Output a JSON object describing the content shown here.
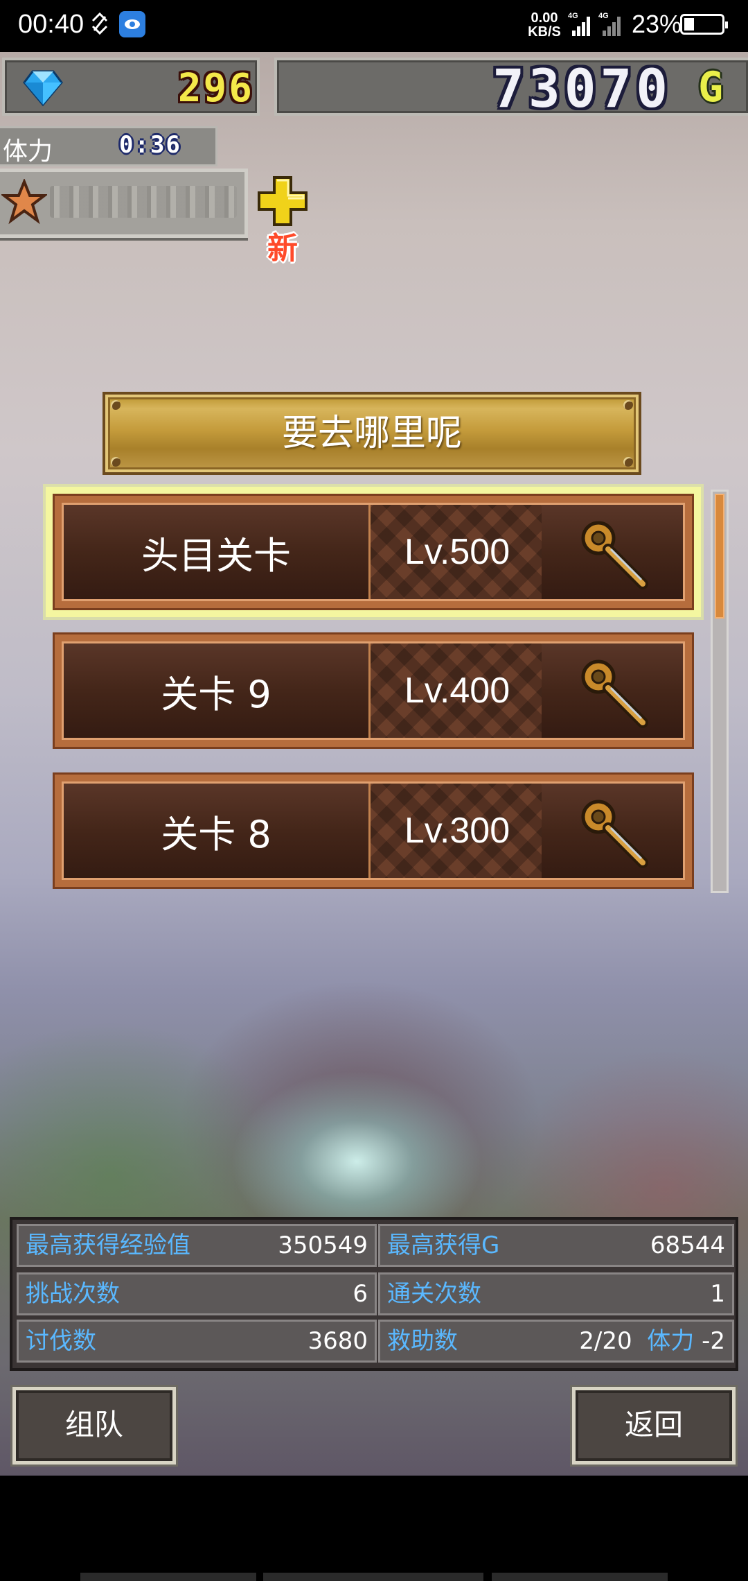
{
  "status_bar": {
    "time": "00:40",
    "network_speed_value": "0.00",
    "network_speed_unit": "KB/S",
    "signal1_label": "4G",
    "signal2_label": "4G",
    "battery_percent": "23%"
  },
  "hud": {
    "gems": "296",
    "gold": "73070",
    "gold_unit": "G",
    "stamina_label": "体力",
    "stamina_timer": "0:36",
    "new_badge": "新"
  },
  "screen": {
    "title": "要去哪里呢"
  },
  "levels": [
    {
      "name": "头目关卡",
      "level": "Lv.500",
      "selected": true
    },
    {
      "name": "关卡 9",
      "level": "Lv.400",
      "selected": false
    },
    {
      "name": "关卡 8",
      "level": "Lv.300",
      "selected": false
    }
  ],
  "stats": {
    "max_exp_label": "最高获得经验值",
    "max_exp_value": "350549",
    "max_gold_label": "最高获得G",
    "max_gold_value": "68544",
    "challenges_label": "挑战次数",
    "challenges_value": "6",
    "clears_label": "通关次数",
    "clears_value": "1",
    "defeats_label": "讨伐数",
    "defeats_value": "3680",
    "rescue_label": "救助数",
    "rescue_value": "2/20",
    "rescue_stamina_label": "体力",
    "rescue_stamina_value": "-2"
  },
  "buttons": {
    "party": "组队",
    "back": "返回"
  },
  "colors": {
    "gem_count": "#f4e84a",
    "gold_unit": "#e9ef4a",
    "stat_label": "#5ab8ff",
    "selected_outline": "#f4f6a0",
    "new_badge": "#ff4a2a"
  },
  "icons": {
    "gem": "diamond-icon",
    "star": "star-icon",
    "plus": "plus-icon",
    "key": "key-icon"
  }
}
